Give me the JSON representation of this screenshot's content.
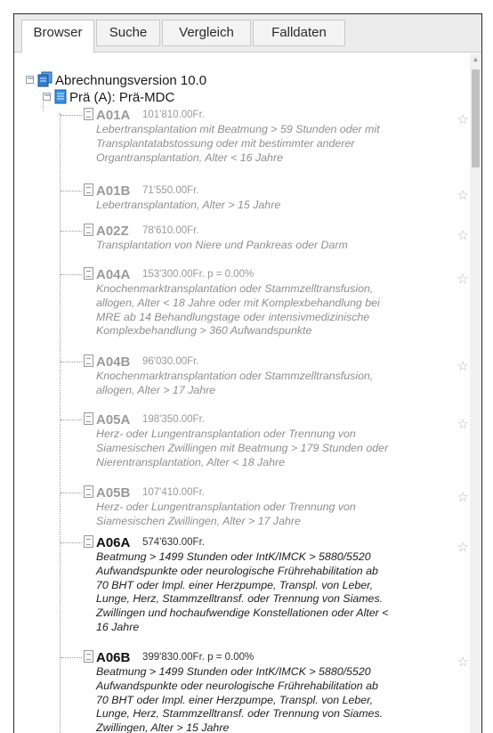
{
  "tabs": [
    {
      "label": "Browser",
      "active": true
    },
    {
      "label": "Suche",
      "active": false
    },
    {
      "label": "Vergleich",
      "active": false
    },
    {
      "label": "Falldaten",
      "active": false
    }
  ],
  "tree": {
    "root_label": "Abrechnungsversion 10.0",
    "root_icon": "stacked-pages-icon",
    "mdc_label": "Prä (A): Prä-MDC",
    "mdc_icon": "page-icon",
    "toggle_symbol": "−",
    "star_symbol": "☆",
    "colors": {
      "icon_blue": "#1e73be",
      "inactive_text": "#9a9a9a",
      "active_text": "#111111"
    },
    "drgs": [
      {
        "code": "A01A",
        "price": "101'810.00Fr.",
        "active": false,
        "desc": [
          "Lebertransplantation mit Beatmung > 59 Stunden oder mit",
          "Transplantatabstossung oder mit bestimmter anderer",
          "Organtransplantation, Alter < 16 Jahre"
        ]
      },
      {
        "code": "A01B",
        "price": "71'550.00Fr.",
        "active": false,
        "desc": [
          "Lebertransplantation, Alter > 15 Jahre"
        ]
      },
      {
        "code": "A02Z",
        "price": "78'610.00Fr.",
        "active": false,
        "desc": [
          "Transplantation von Niere und Pankreas oder Darm"
        ]
      },
      {
        "code": "A04A",
        "price": "153'300.00Fr.  p = 0.00%",
        "active": false,
        "desc": [
          "Knochenmarktransplantation oder Stammzelltransfusion,",
          "allogen, Alter < 18 Jahre oder mit Komplexbehandlung bei",
          "MRE ab 14 Behandlungstage oder intensivmedizinische",
          "Komplexbehandlung > 360 Aufwandspunkte"
        ]
      },
      {
        "code": "A04B",
        "price": "96'030.00Fr.",
        "active": false,
        "desc": [
          "Knochenmarktransplantation oder Stammzelltransfusion,",
          "allogen, Alter > 17 Jahre"
        ]
      },
      {
        "code": "A05A",
        "price": "198'350.00Fr.",
        "active": false,
        "desc": [
          "Herz- oder Lungentransplantation oder Trennung von",
          "Siamesischen Zwillingen mit Beatmung > 179 Stunden oder",
          "Nierentransplantation, Alter < 18 Jahre"
        ]
      },
      {
        "code": "A05B",
        "price": "107'410.00Fr.",
        "active": false,
        "desc": [
          "Herz- oder Lungentransplantation oder Trennung von",
          "Siamesischen Zwillingen, Alter > 17 Jahre"
        ]
      },
      {
        "code": "A06A",
        "price": "574'630.00Fr.",
        "active": true,
        "desc": [
          "Beatmung > 1499 Stunden oder IntK/IMCK > 5880/5520",
          "Aufwandspunkte oder neurologische Frührehabilitation ab",
          "70 BHT oder Impl. einer Herzpumpe, Transpl. von Leber,",
          "Lunge, Herz, Stammzelltransf. oder Trennung von Siames.",
          "Zwillingen und hochaufwendige Konstellationen oder Alter <",
          "16 Jahre"
        ]
      },
      {
        "code": "A06B",
        "price": "399'830.00Fr.  p = 0.00%",
        "active": true,
        "desc": [
          "Beatmung > 1499 Stunden oder IntK/IMCK > 5880/5520",
          "Aufwandspunkte oder neurologische Frührehabilitation ab",
          "70 BHT oder Impl. einer Herzpumpe, Transpl. von Leber,",
          "Lunge, Herz, Stammzelltransf. oder Trennung von Siames.",
          "Zwillingen, Alter > 15 Jahre"
        ]
      }
    ]
  },
  "scrollbar": {
    "up_arrow": "▲"
  }
}
